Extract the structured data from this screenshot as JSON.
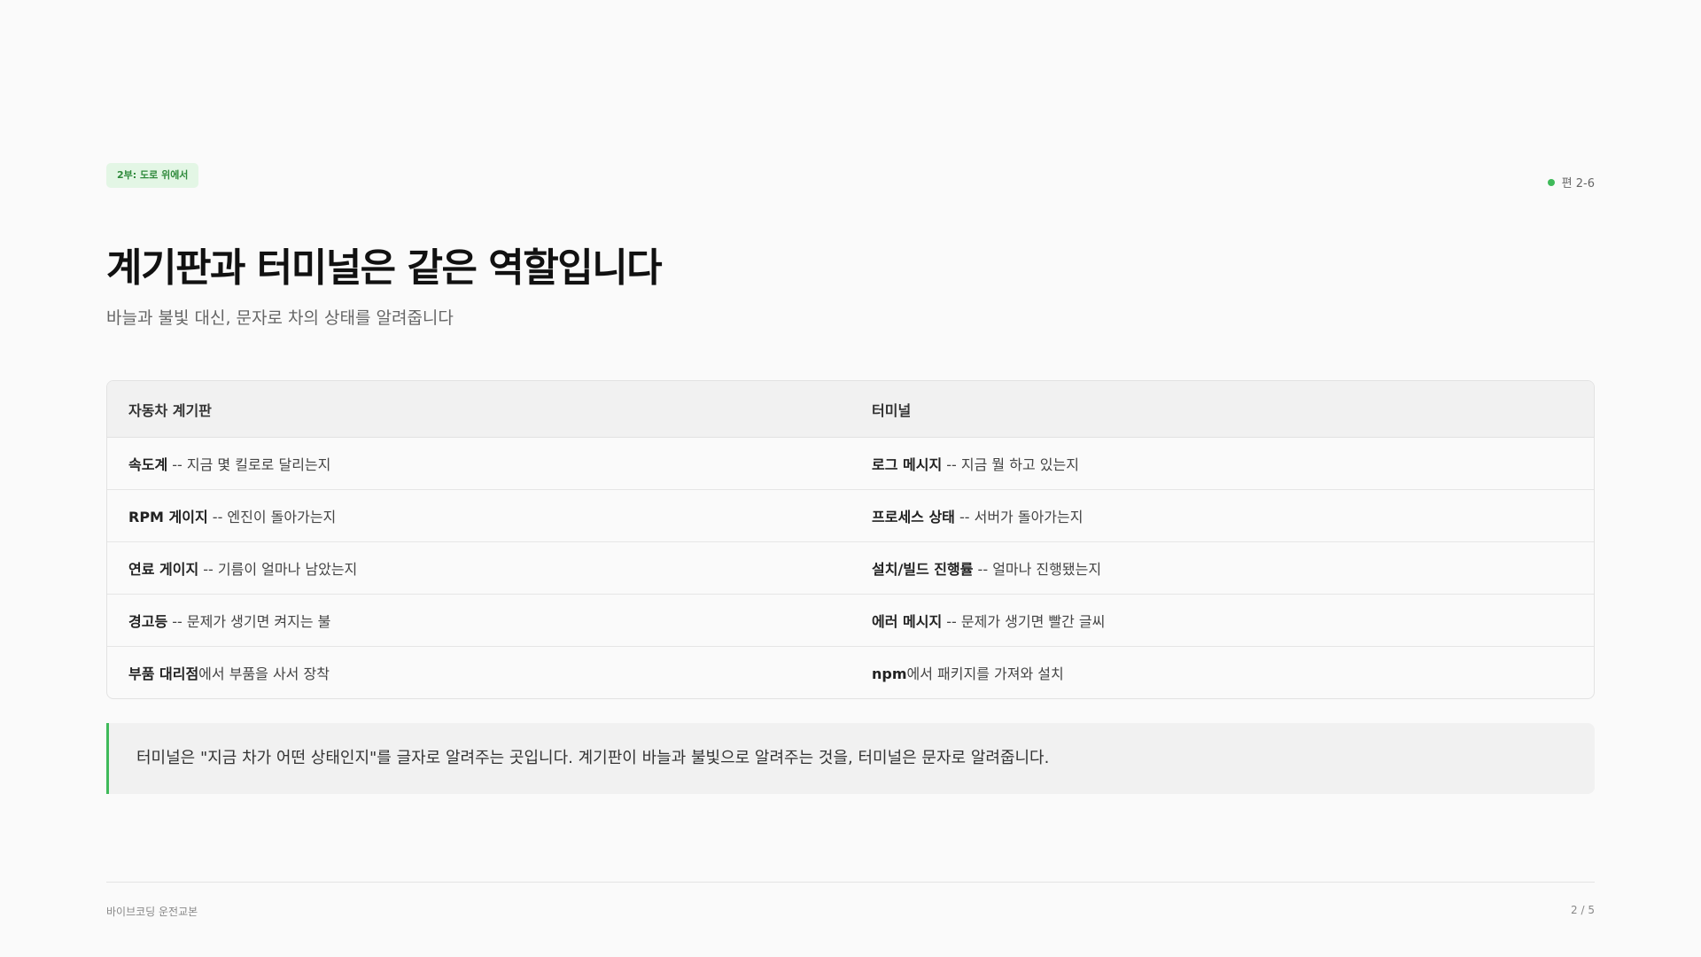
{
  "header": {
    "badge": "2부: 도로 위에서",
    "episode": "편 2-6",
    "title": "계기판과 터미널은 같은 역할입니다",
    "subtitle": "바늘과 불빛 대신, 문자로 차의 상태를 알려줍니다"
  },
  "table": {
    "headers": [
      "자동차 계기판",
      "터미널"
    ],
    "rows": [
      {
        "left_bold": "속도계",
        "left_rest": " -- 지금 몇 킬로로 달리는지",
        "right_bold": "로그 메시지",
        "right_rest": " -- 지금 뭘 하고 있는지"
      },
      {
        "left_bold": "RPM 게이지",
        "left_rest": " -- 엔진이 돌아가는지",
        "right_bold": "프로세스 상태",
        "right_rest": " -- 서버가 돌아가는지"
      },
      {
        "left_bold": "연료 게이지",
        "left_rest": " -- 기름이 얼마나 남았는지",
        "right_bold": "설치/빌드 진행률",
        "right_rest": " -- 얼마나 진행됐는지"
      },
      {
        "left_bold": "경고등",
        "left_rest": " -- 문제가 생기면 켜지는 불",
        "right_bold": "에러 메시지",
        "right_rest": " -- 문제가 생기면 빨간 글씨"
      },
      {
        "left_bold": "부품 대리점",
        "left_rest": "에서 부품을 사서 장착",
        "right_bold": "npm",
        "right_rest": "에서 패키지를 가져와 설치"
      }
    ]
  },
  "callout": {
    "text": "터미널은 \"지금 차가 어떤 상태인지\"를 글자로 알려주는 곳입니다. 계기판이 바늘과 불빛으로 알려주는 것을, 터미널은 문자로 알려줍니다."
  },
  "footer": {
    "left": "바이브코딩 운전교본",
    "right": "2 / 5"
  },
  "colors": {
    "accent": "#3fba5a",
    "badge_bg": "#e3f6e5",
    "badge_text": "#2f8a3c"
  }
}
